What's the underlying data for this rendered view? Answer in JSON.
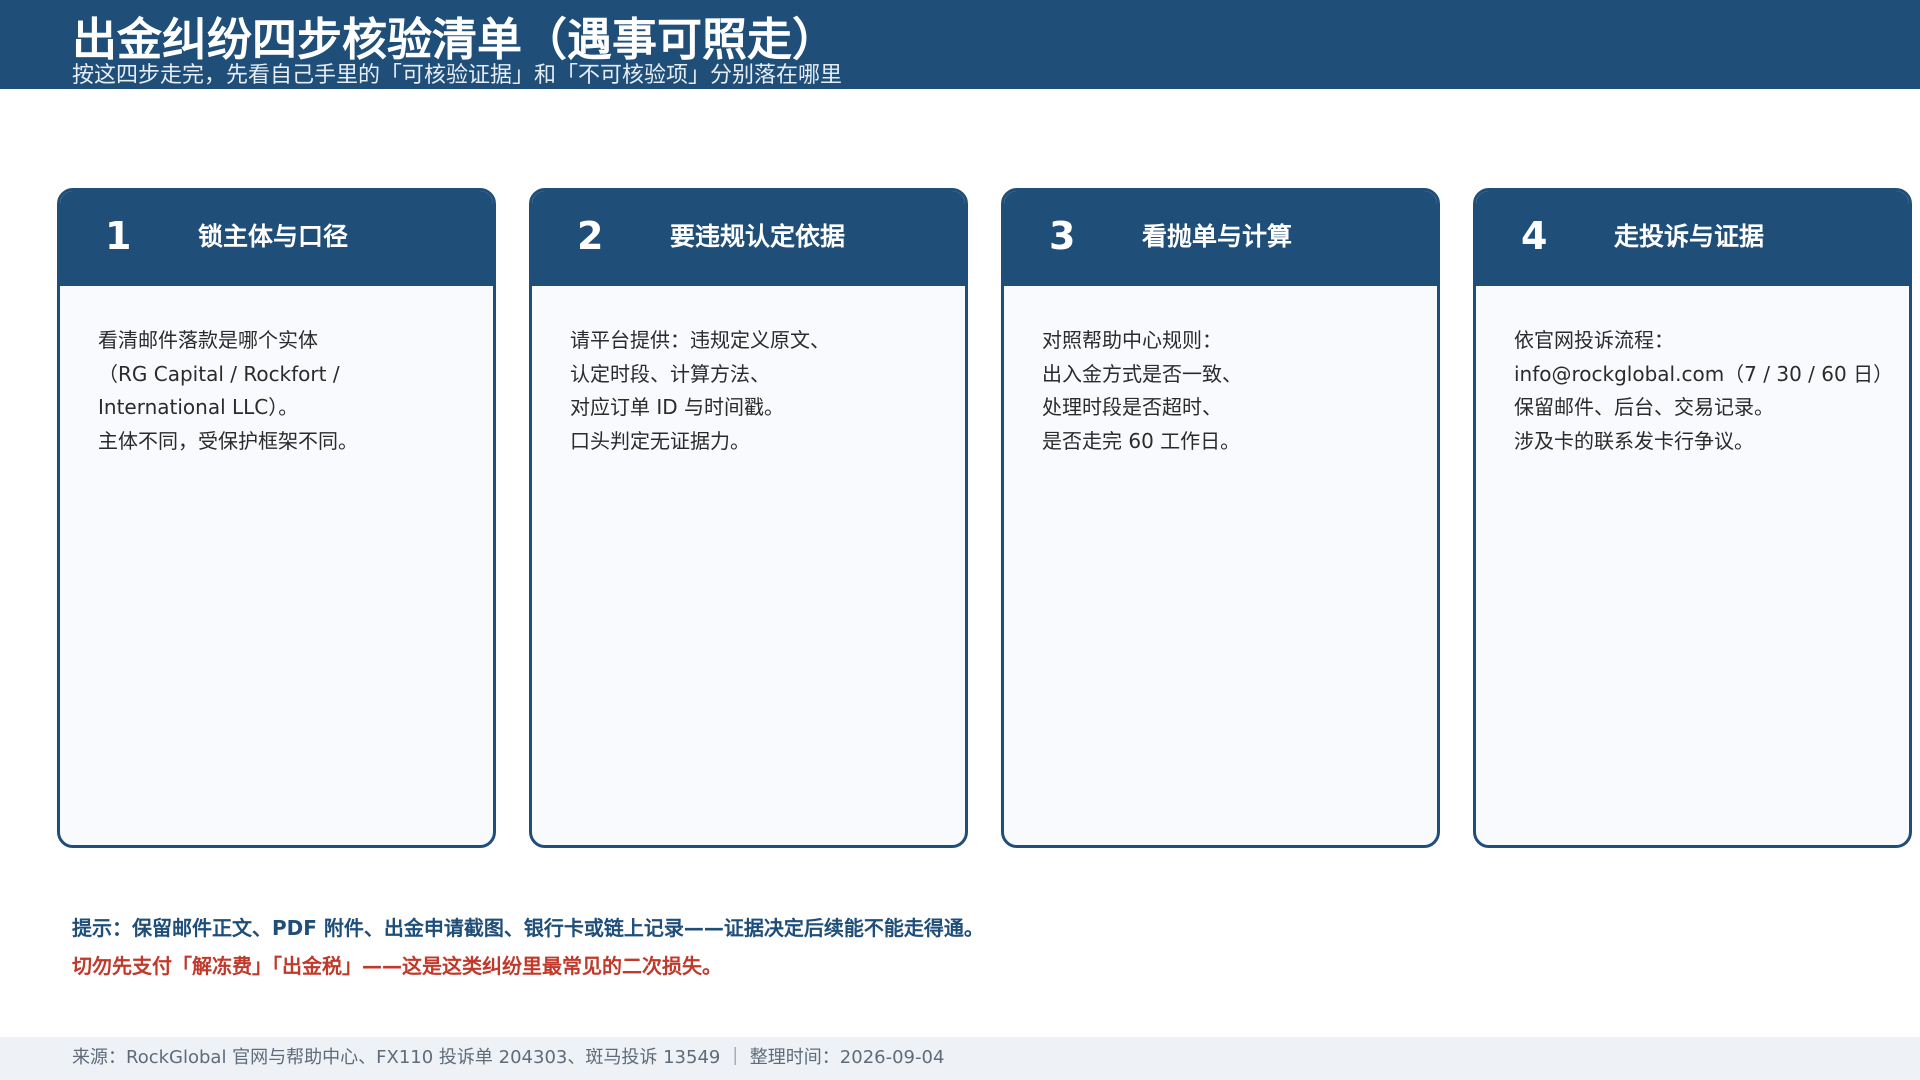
{
  "header": {
    "title": "出金纠纷四步核验清单（遇事可照走）",
    "subtitle": "按这四步走完，先看自己手里的「可核验证据」和「不可核验项」分别落在哪里"
  },
  "steps": [
    {
      "number": "1",
      "title": "锁主体与口径",
      "lines": [
        "看清邮件落款是哪个实体",
        "（RG Capital / Rockfort /",
        "International LLC）。",
        "主体不同，受保护框架不同。"
      ]
    },
    {
      "number": "2",
      "title": "要违规认定依据",
      "lines": [
        "请平台提供：违规定义原文、",
        "认定时段、计算方法、",
        "对应订单 ID 与时间戳。",
        "口头判定无证据力。"
      ]
    },
    {
      "number": "3",
      "title": "看抛单与计算",
      "lines": [
        "对照帮助中心规则：",
        "出入金方式是否一致、",
        "处理时段是否超时、",
        "是否走完 60 工作日。"
      ]
    },
    {
      "number": "4",
      "title": "走投诉与证据",
      "lines": [
        "依官网投诉流程：",
        "info@rockglobal.com（7 / 30 / 60 日）",
        "保留邮件、后台、交易记录。",
        "涉及卡的联系发卡行争议。"
      ]
    }
  ],
  "notes": {
    "tip": "提示：保留邮件正文、PDF 附件、出金申请截图、银行卡或链上记录——证据决定后续能不能走得通。",
    "warning": "切勿先支付「解冻费」「出金税」——这是这类纠纷里最常见的二次损失。"
  },
  "footer": {
    "text": "来源：RockGlobal 官网与帮助中心、FX110 投诉单 204303、斑马投诉 13549 ｜ 整理时间：2026-09-04"
  },
  "colors": {
    "primary": "#1f4e79",
    "warning": "#c0392b",
    "card_bg": "#f8fafd",
    "footer_bg": "#eef2f6"
  }
}
